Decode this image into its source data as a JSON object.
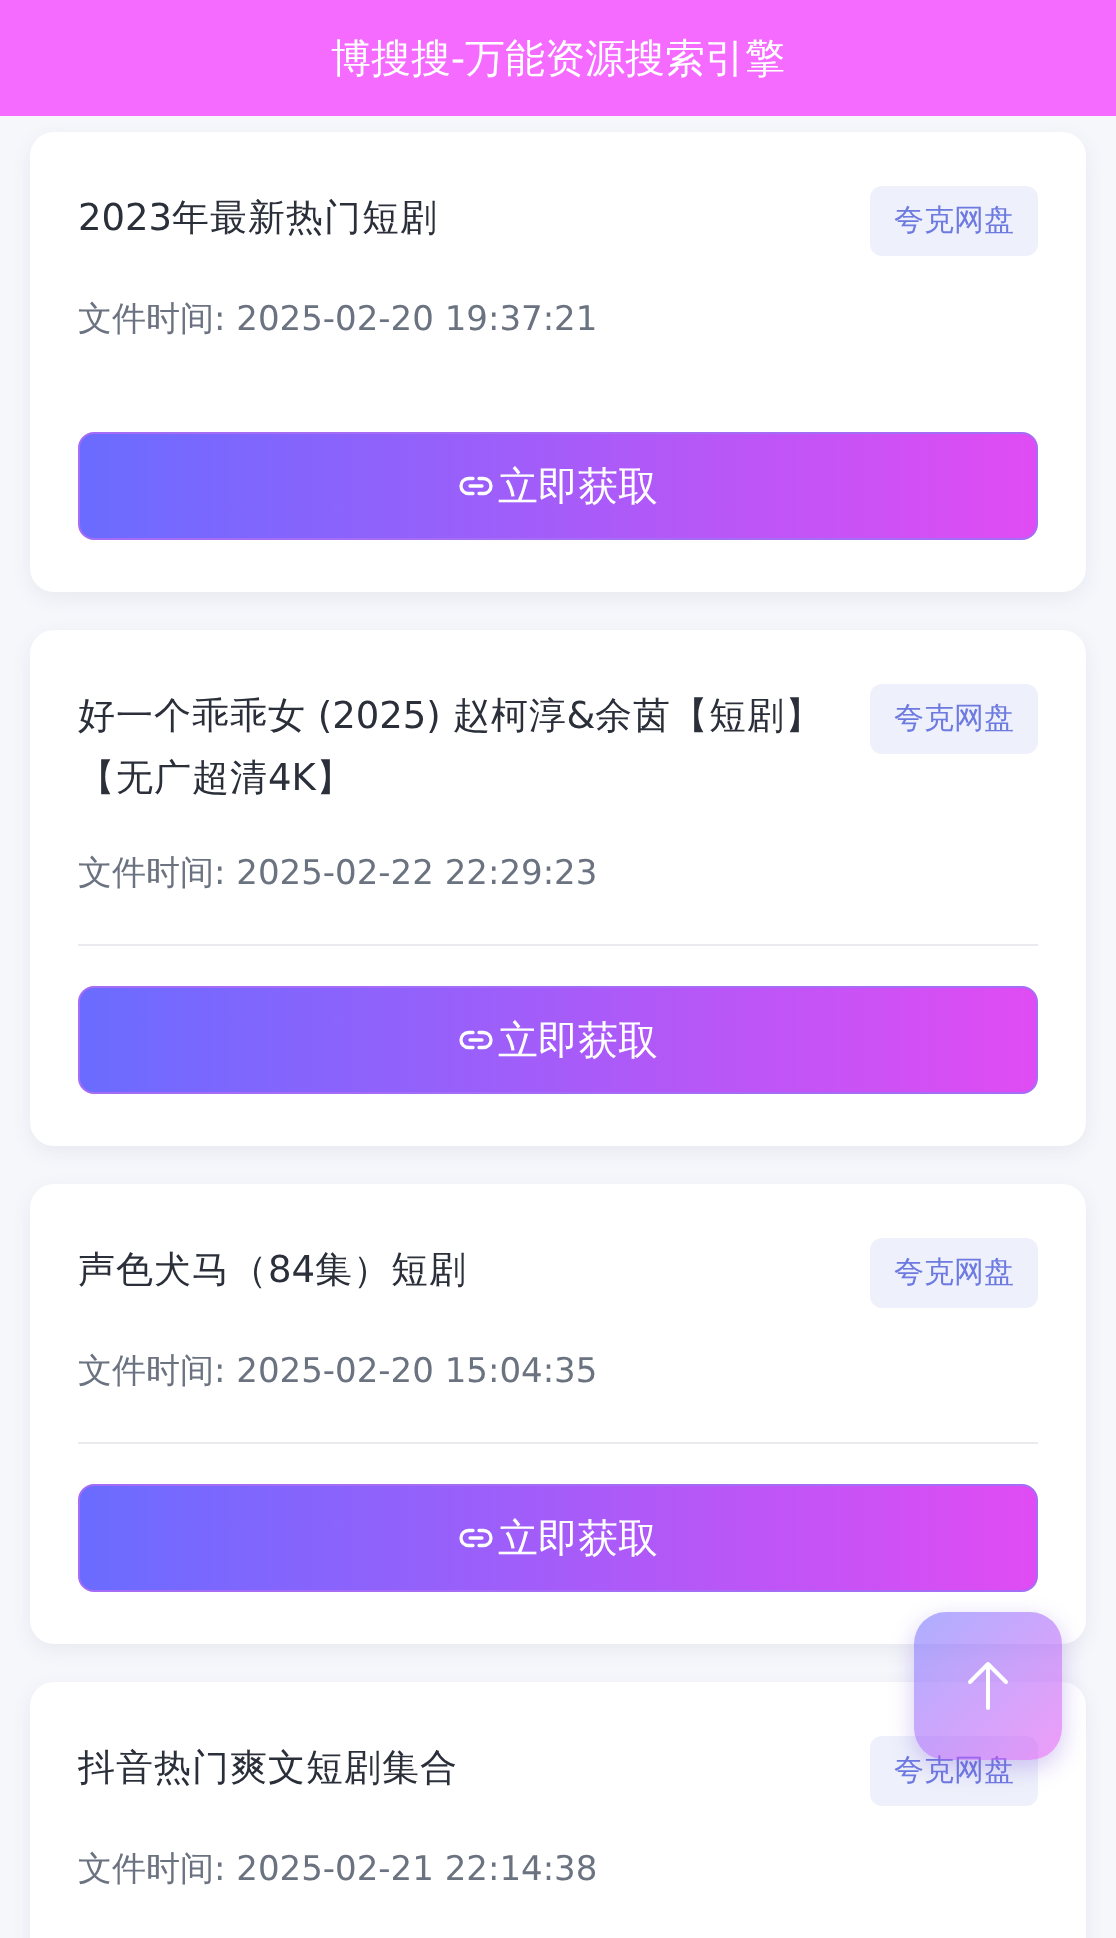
{
  "header": {
    "title": "博搜搜-万能资源搜索引擎"
  },
  "results": [
    {
      "title": "2023年最新热门短剧",
      "tag": "夸克网盘",
      "time": "文件时间: 2025-02-20 19:37:21",
      "divider": false,
      "button": "立即获取"
    },
    {
      "title": "好一个乖乖女 (2025) 赵柯淳&余茵【短剧】【无广超清4K】",
      "tag": "夸克网盘",
      "time": "文件时间: 2025-02-22 22:29:23",
      "divider": true,
      "button": "立即获取"
    },
    {
      "title": "声色犬马（84集）短剧",
      "tag": "夸克网盘",
      "time": "文件时间: 2025-02-20 15:04:35",
      "divider": true,
      "button": "立即获取"
    },
    {
      "title": "抖音热门爽文短剧集合",
      "tag": "夸克网盘",
      "time": "文件时间: 2025-02-21 22:14:38"
    }
  ]
}
